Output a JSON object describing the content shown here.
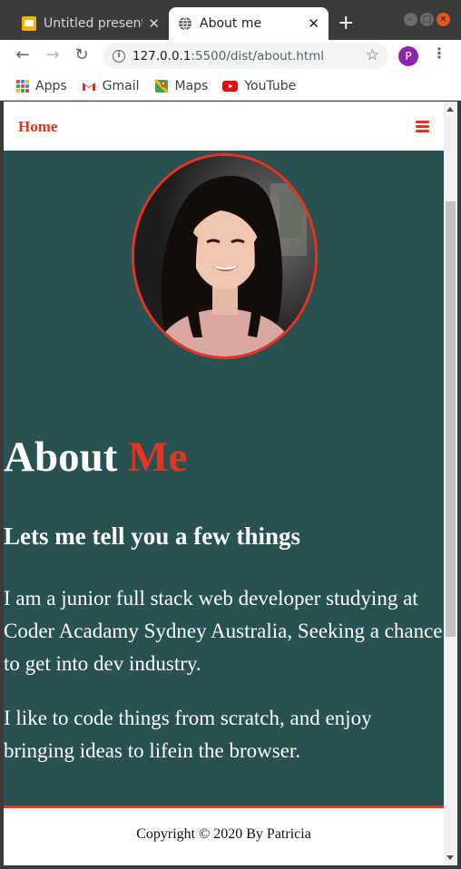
{
  "browser": {
    "tabs": [
      {
        "title": "Untitled presentation",
        "active": false
      },
      {
        "title": "About me",
        "active": true
      }
    ],
    "url_host": "127.0.0.1",
    "url_path": ":5500/dist/about.html",
    "profile_initial": "P",
    "bookmarks": [
      {
        "label": "Apps",
        "icon": "apps-grid-icon"
      },
      {
        "label": "Gmail",
        "icon": "gmail-icon"
      },
      {
        "label": "Maps",
        "icon": "maps-icon"
      },
      {
        "label": "YouTube",
        "icon": "youtube-icon"
      }
    ]
  },
  "page": {
    "nav": {
      "home_label": "Home",
      "menu_icon": "hamburger-icon"
    },
    "heading": {
      "about": "About",
      "me": "Me"
    },
    "subheading": "Lets me tell you a few things",
    "paragraphs": [
      "I am a junior full stack web developer studying at Coder Acadamy Sydney Australia, Seeking a chance to get into dev industry.",
      "I like to code things from scratch, and enjoy bringing ideas to lifein the browser."
    ],
    "footer": "Copyright © 2020 By Patricia"
  },
  "colors": {
    "accent": "#e8331f",
    "hero_bg": "#285151",
    "text_on_hero": "#ffffff"
  }
}
